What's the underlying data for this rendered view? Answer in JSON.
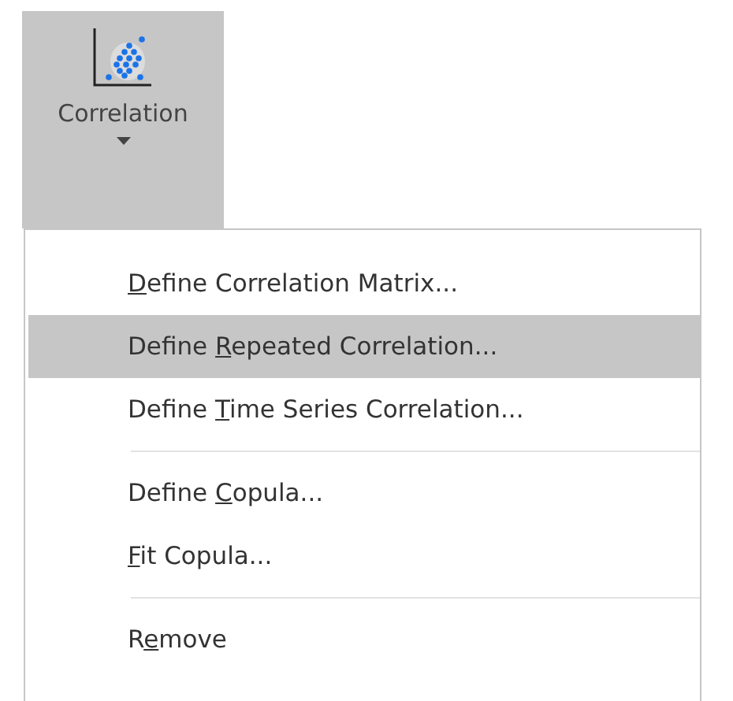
{
  "ribbon_button": {
    "label": "Correlation",
    "pressed": true
  },
  "menu": {
    "items": [
      {
        "kind": "item",
        "access_key": "D",
        "text_after": "efine Correlation Matrix...",
        "selected": false
      },
      {
        "kind": "item",
        "text_before": "Define ",
        "access_key": "R",
        "text_after": "epeated Correlation...",
        "selected": true
      },
      {
        "kind": "item",
        "text_before": "Define ",
        "access_key": "T",
        "text_after": "ime Series Correlation...",
        "selected": false
      },
      {
        "kind": "separator"
      },
      {
        "kind": "item",
        "text_before": "Define ",
        "access_key": "C",
        "text_after": "opula...",
        "selected": false
      },
      {
        "kind": "item",
        "access_key": "F",
        "text_after": "it Copula...",
        "selected": false
      },
      {
        "kind": "separator"
      },
      {
        "kind": "item",
        "text_before": "R",
        "access_key": "e",
        "text_after": "move",
        "selected": false
      }
    ]
  }
}
